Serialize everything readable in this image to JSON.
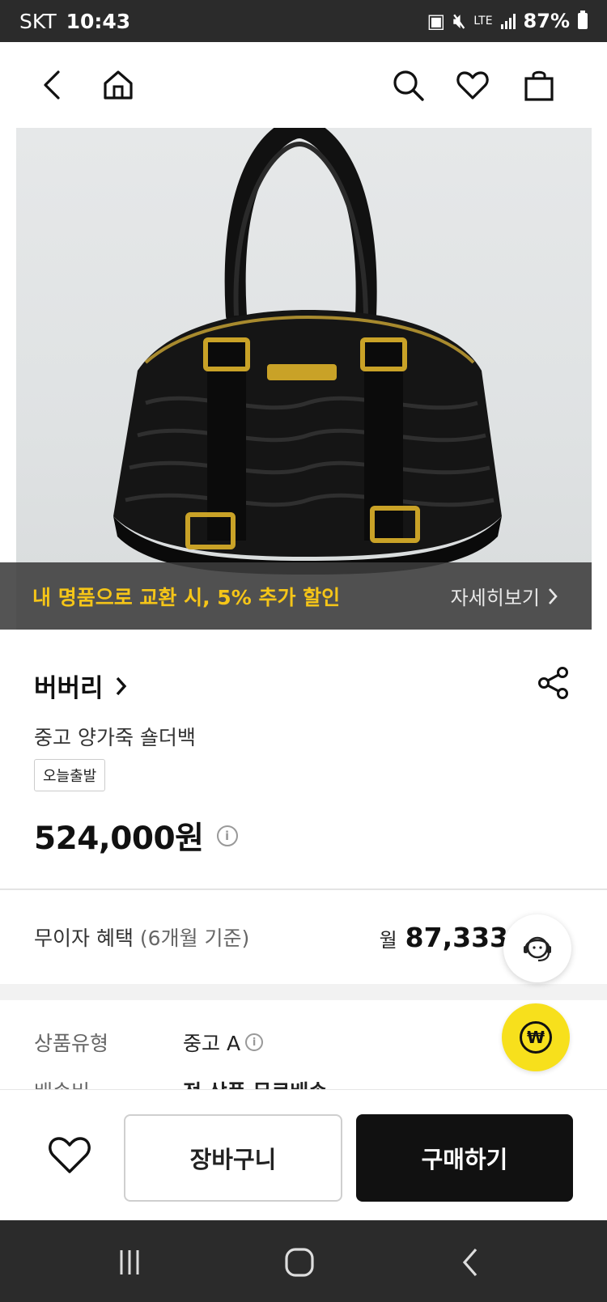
{
  "status_bar": {
    "carrier": "SKT",
    "time": "10:43",
    "network": "LTE",
    "battery": "87%"
  },
  "header": {
    "icons": [
      "back-icon",
      "home-icon",
      "search-icon",
      "heart-icon",
      "shopping-bag-icon"
    ]
  },
  "banner": {
    "promo_text": "내 명품으로 교환 시, 5% 추가 할인",
    "link_label": "자세히보기"
  },
  "product": {
    "brand": "버버리",
    "name": "중고 양가죽 숄더백",
    "tag": "오늘출발",
    "price": "524,000원"
  },
  "installment": {
    "label": "무이자 혜택",
    "sub": "(6개월 기준)",
    "month_prefix": "월",
    "amount": "87,333"
  },
  "details": [
    {
      "label": "상품유형",
      "value": "중고 A"
    },
    {
      "label": "배송비",
      "value": "전 상품 무료배송"
    }
  ],
  "actions": {
    "cart_label": "장바구니",
    "buy_label": "구매하기"
  },
  "colors": {
    "promo_accent": "#f5c518",
    "fab_yellow": "#f7e01c",
    "buy_button": "#111111"
  }
}
